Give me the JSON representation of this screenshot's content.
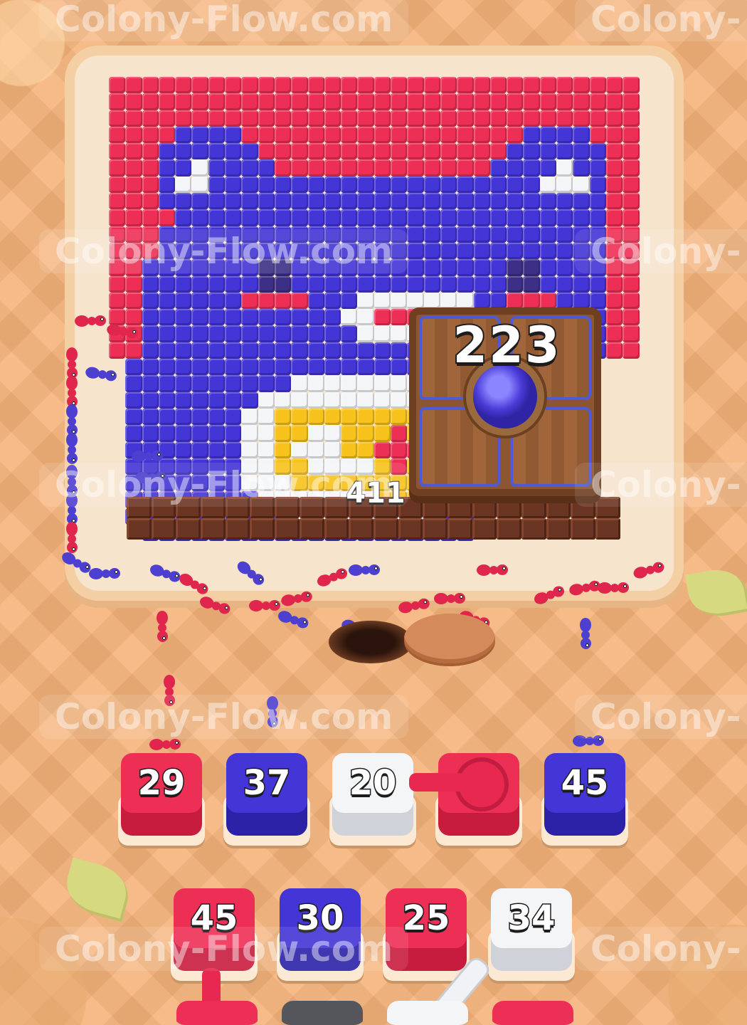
{
  "watermark": "Colony-Flow.com",
  "watermark_partial": "Colony-",
  "chest": {
    "count": "223"
  },
  "chocolate": {
    "count": "411"
  },
  "tray_row1": [
    {
      "value": "29",
      "color": "red"
    },
    {
      "value": "37",
      "color": "blue"
    },
    {
      "value": "20",
      "color": "white"
    },
    {
      "value": "",
      "color": "red",
      "locked": true
    },
    {
      "value": "45",
      "color": "blue"
    }
  ],
  "tray_row2": [
    {
      "value": "45",
      "color": "red"
    },
    {
      "value": "30",
      "color": "blue"
    },
    {
      "value": "25",
      "color": "red"
    },
    {
      "value": "34",
      "color": "white"
    }
  ],
  "palette": {
    "red": "#ee2f55",
    "blue": "#4335d6",
    "white": "#f4f5f7",
    "yellow": "#f7c21b",
    "chocolate": "#6b3524"
  },
  "mosaic_rows": [
    "RRRRRRRRRRRRRRRRRRRRRRRRRRRRRRRR",
    "RRRRRRRRRRRRRRRRRRRRRRRRRRRRRRRR",
    "RRRRRRRRRRRRRRRRRRRRRRRRRRRRRRRR",
    "RRRRBBBBRRRRRRRRRRRRRRRRRBBBBRRR",
    "RRRBBBBBBRRRRRRRRRRRRRRRBBBBBBRR",
    "RRRBBWBBBBRRRRRRRRRRRRRBBBBWBBRR",
    "RRRBWWBBBBBBBBBBBBBBBBBBBBWWWBRR",
    "RRRBBBBBBBBBBBBBBBBBBBBBBBBBBBRR",
    "RRRRBBBBBBBBBBBBBBBBBBBBBBBBBBRR",
    "RRRBBBBBBBBBBBBBBBBBBBBBBBBBBBRR",
    "RRRBBBBBBBBBBBBBBBBBBBBBBBBBBBRR",
    "RRBBBBBBBDDBBBBBBBBBBBBBDDBBBBRR",
    "RRBBBBBBBDDBBBBBBBBBBBBBDDBBBBRR",
    "RRBBBBBBRRRRBBBWWWWWWWBBRRRBBBRR",
    "RRBBBBBBBBBBBBWWRRRRRWWBBBBBBBRR",
    "RRBBBBBBBBBBBBBWWWWWWWBBBBBBBBRR",
    "RRBBBBBBBBBBBBBBBBBBBBBBBBBBBBRR",
    "-BBBBBBBBBBBBBBBBBBBBBB---------",
    "-BBBBBBBBBBWWWWWWWWWBBB---------",
    "-BBBBBBBBWWWWWWWWWWWWBB---------",
    "-BBBBBBBWWYYYYYYYYYYBB---------",
    "-BBBBBBBWWYYWWYYYRYYYB---------",
    "-BBBBBBBWWYWWWYYRRRYYB---------",
    "-BBBBBBBWWYYWWWWYRYYYB---------",
    "-BBBBBBBWWWYYYYYYYYYBB---------",
    "-BBBBBBBBWWWWWWWYYYYBB---------",
    "-BBBBBBBBBBWWWWWWWWBBB---------",
    "--BBBBBBBBBBBBBBBBBBBB---------"
  ]
}
